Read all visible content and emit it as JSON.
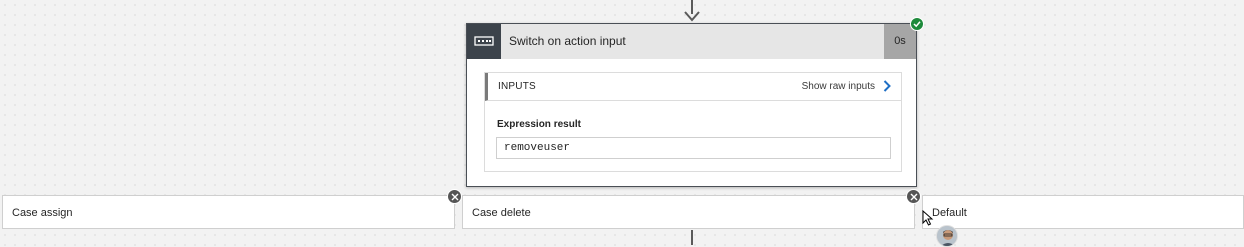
{
  "switch_action": {
    "title": "Switch on action input",
    "duration": "0s",
    "status": "succeeded",
    "inputs": {
      "section_label": "INPUTS",
      "show_raw_label": "Show raw inputs",
      "expression_label": "Expression result",
      "expression_value": "removeuser"
    }
  },
  "cases": [
    {
      "label": "Case assign"
    },
    {
      "label": "Case delete"
    },
    {
      "label": "Default"
    }
  ],
  "icons": {
    "action_icon": "switch-icon",
    "status_icon": "checkmark-icon",
    "remove_icon": "close-icon",
    "raw_inputs_icon": "chevron-right-icon"
  },
  "colors": {
    "header_dark": "#3c434b",
    "success_green": "#1e8a3b",
    "accent_blue": "#1f6fc5"
  }
}
